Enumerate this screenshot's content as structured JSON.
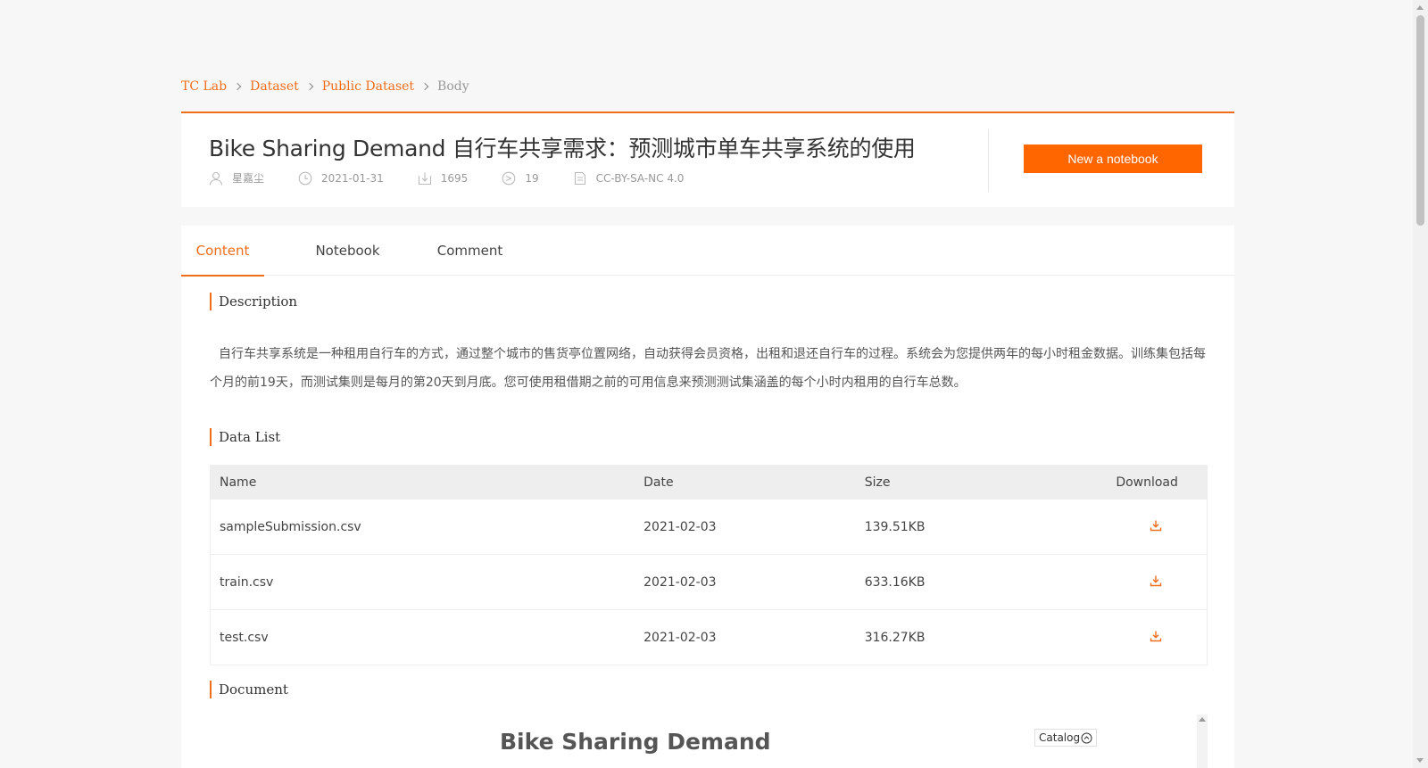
{
  "breadcrumb": {
    "items": [
      "TC Lab",
      "Dataset",
      "Public Dataset"
    ],
    "current": "Body"
  },
  "dataset": {
    "title": "Bike Sharing Demand 自行车共享需求：预测城市单车共享系统的使用",
    "author": "星嘉尘",
    "date": "2021-01-31",
    "downloads": "1695",
    "forks": "19",
    "license": "CC-BY-SA-NC 4.0"
  },
  "actions": {
    "new_notebook_label": "New a notebook"
  },
  "tabs": [
    {
      "label": "Content",
      "active": true
    },
    {
      "label": "Notebook",
      "active": false
    },
    {
      "label": "Comment",
      "active": false
    }
  ],
  "sections": {
    "description_title": "Description",
    "description_text": "自行车共享系统是一种租用自行车的方式，通过整个城市的售货亭位置网络，自动获得会员资格，出租和退还自行车的过程。系统会为您提供两年的每小时租金数据。训练集包括每个月的前19天，而测试集则是每月的第20天到月底。您可使用租借期之前的可用信息来预测测试集涵盖的每个小时内租用的自行车总数。",
    "data_list_title": "Data List",
    "document_title": "Document"
  },
  "table": {
    "headers": {
      "name": "Name",
      "date": "Date",
      "size": "Size",
      "download": "Download"
    },
    "rows": [
      {
        "name": "sampleSubmission.csv",
        "date": "2021-02-03",
        "size": "139.51KB"
      },
      {
        "name": "train.csv",
        "date": "2021-02-03",
        "size": "633.16KB"
      },
      {
        "name": "test.csv",
        "date": "2021-02-03",
        "size": "316.27KB"
      }
    ]
  },
  "document": {
    "heading": "Bike Sharing Demand",
    "catalog_label": "Catalog"
  },
  "colors": {
    "accent": "#f06d1a",
    "button": "#ff6600"
  },
  "icons": {
    "author": "user-icon",
    "date": "clock-icon",
    "downloads": "download-count-icon",
    "forks": "fork-icon",
    "license": "document-icon",
    "row_download": "download-icon",
    "catalog": "circle-chevron-up-icon"
  }
}
